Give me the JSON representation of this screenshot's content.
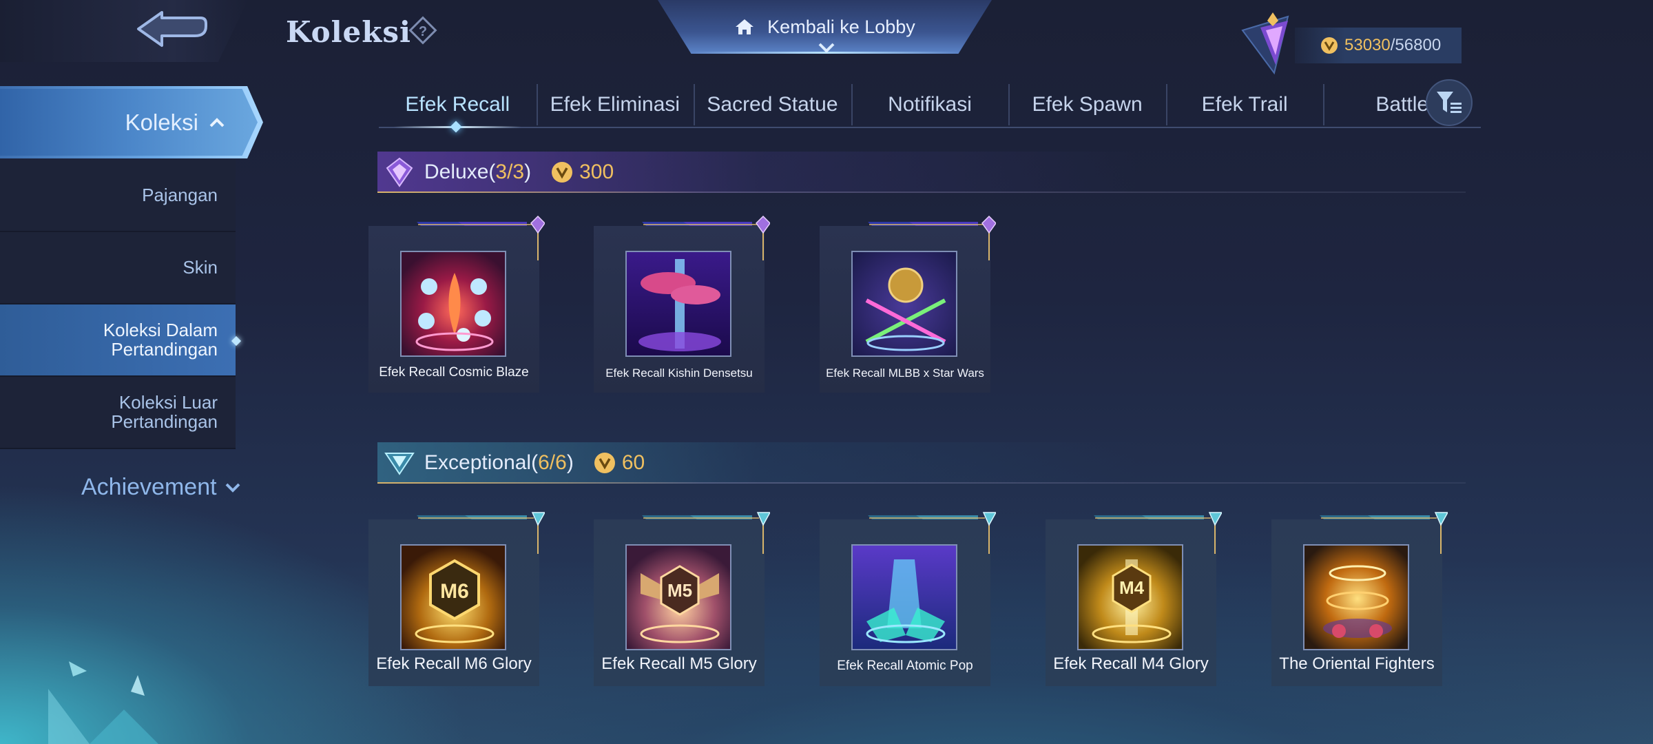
{
  "header": {
    "title": "Koleksi",
    "lobby_label": "Kembali ke Lobby",
    "points_current": "53030",
    "points_sep": "/",
    "points_max": "56800"
  },
  "sidebar": {
    "top_label": "Koleksi",
    "items": [
      {
        "label": "Pajangan",
        "active": false
      },
      {
        "label": "Skin",
        "active": false
      },
      {
        "label": "Koleksi Dalam Pertandingan",
        "active": true
      },
      {
        "label": "Koleksi Luar Pertandingan",
        "active": false
      }
    ],
    "achievement_label": "Achievement"
  },
  "tabs": [
    {
      "label": "Efek Recall",
      "active": true
    },
    {
      "label": "Efek Eliminasi",
      "active": false
    },
    {
      "label": "Sacred Statue",
      "active": false
    },
    {
      "label": "Notifikasi",
      "active": false
    },
    {
      "label": "Efek Spawn",
      "active": false
    },
    {
      "label": "Efek Trail",
      "active": false
    },
    {
      "label": "Battle",
      "active": false
    }
  ],
  "sections": {
    "deluxe": {
      "name": "Deluxe",
      "open_paren": "(",
      "count": "3/3",
      "close_paren": ")",
      "price": "300",
      "items": [
        "Efek Recall Cosmic Blaze",
        "Efek Recall Kishin Densetsu",
        "Efek Recall MLBB x Star Wars"
      ]
    },
    "exceptional": {
      "name": "Exceptional",
      "open_paren": "(",
      "count": "6/6",
      "close_paren": ")",
      "price": "60",
      "items": [
        "Efek Recall M6 Glory",
        "Efek Recall M5 Glory",
        "Efek Recall Atomic Pop",
        "Efek Recall M4 Glory",
        "The Oriental Fighters"
      ]
    }
  },
  "colors": {
    "accent_gold": "#f0c060",
    "deluxe_purple": "#8a5ad8",
    "exceptional_teal": "#5fc6d8",
    "active_blue": "#3c6fb3"
  },
  "icons": [
    "back-arrow-icon",
    "help-icon",
    "home-icon",
    "chevron-down-icon",
    "rank-badge-icon",
    "battle-point-icon",
    "chevron-up-icon",
    "filter-icon",
    "deluxe-gem-icon",
    "exceptional-gem-icon"
  ],
  "thumb_labels": {
    "m6": "M6",
    "m5": "M5",
    "m4": "M4"
  }
}
